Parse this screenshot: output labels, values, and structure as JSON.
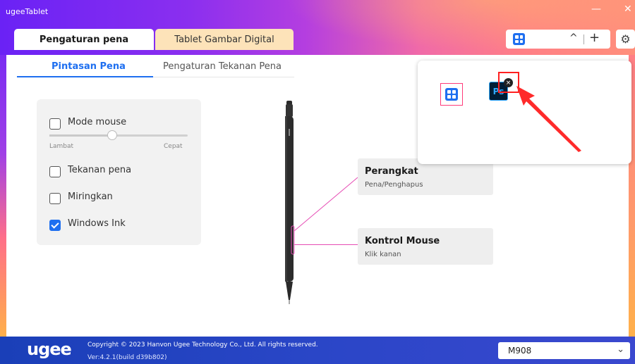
{
  "window": {
    "title": "ugeeTablet",
    "minimize": "—",
    "close": "✕"
  },
  "top_tabs": [
    {
      "label": "Pengaturan pena",
      "active": true
    },
    {
      "label": "Tablet Gambar Digital",
      "active": false
    }
  ],
  "app_selector": {
    "icon": "app-grid-icon",
    "caret": "^",
    "plus": "+"
  },
  "settings_icon": "⚙",
  "sub_tabs": [
    {
      "label": "Pintasan Pena",
      "active": true
    },
    {
      "label": "Pengaturan Tekanan Pena",
      "active": false
    }
  ],
  "pen_settings": {
    "mouse_mode": {
      "label": "Mode mouse",
      "checked": false
    },
    "speed": {
      "slow": "Lambat",
      "fast": "Cepat",
      "value_fraction": 0.45
    },
    "pen_pressure": {
      "label": "Tekanan pena",
      "checked": false
    },
    "tilt": {
      "label": "Miringkan",
      "checked": false
    },
    "windows_ink": {
      "label": "Windows Ink",
      "checked": true
    }
  },
  "buttons": [
    {
      "title": "Perangkat",
      "subtitle": "Pena/Penghapus"
    },
    {
      "title": "Kontrol Mouse",
      "subtitle": "Klik kanan"
    }
  ],
  "popup": {
    "apps": [
      {
        "name": "app-grid-icon",
        "selected": true
      },
      {
        "name": "photoshop-icon",
        "label": "Ps"
      }
    ],
    "remove_icon": "×"
  },
  "footer": {
    "logo": "ugee",
    "copyright": "Copyright © 2023 Hanvon Ugee Technology Co., Ltd. All rights reserved.",
    "version": "Ver:4.2.1(build d39b802)",
    "device": "M908",
    "device_caret": "⌄"
  },
  "colors": {
    "accent": "#1e6ff0",
    "highlight": "#ff2020",
    "pen_line": "#e64bb4",
    "footer": "#2a46c7"
  }
}
